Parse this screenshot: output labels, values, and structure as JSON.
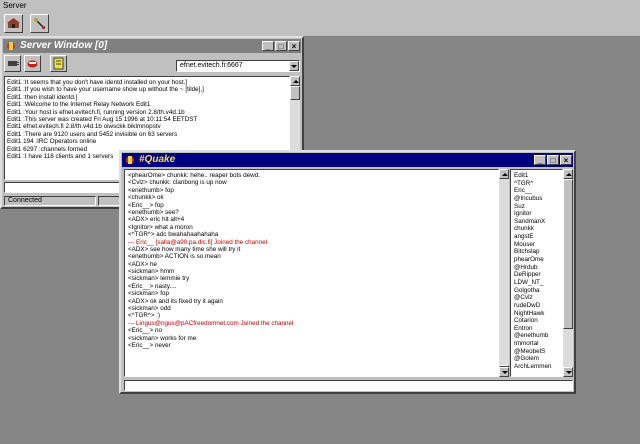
{
  "menu": {
    "items": [
      "Server"
    ]
  },
  "toolbar": {
    "buttons": [
      "connect-icon",
      "options-icon"
    ]
  },
  "server_window": {
    "title": "Server Window [0]",
    "server_select": "efnet.evitech.fi:6667",
    "lines": [
      "Edit1 :It seems that you don't have identd installed on your host.]",
      "Edit1 :If you wish to have your username show up without the ~ [tilde],]",
      "Edit1 :then install identd.]",
      "Edit1 :Welcome to the Internet Relay Network Edit1",
      "Edit1 :Your host is efnet.evitech.fi, running version 2.8/th.v4d.1b",
      "Edit1 :This server was created Fri Aug 15 1996 at 10:11:54 EETDST",
      "Edit1 efnet.evitech.fi 2.8/th.v4d.1b oiwsckk biklmnopstv",
      "Edit1 :There are 9120 users and 5452 invisible on 63 servers",
      "Edit1 194 :IRC Operators online",
      "Edit1 6297 :channels formed",
      "Edit1 :I have 118 clients and 1 servers"
    ],
    "status": "Connected"
  },
  "channel_window": {
    "title": "#Quake",
    "messages": [
      {
        "text": "<phearOme> chunkk: hehe.. reaper bots dewd.",
        "color": "#000000"
      },
      {
        "text": "<Cvlz> chunkk: clanbong is up now",
        "color": "#000000"
      },
      {
        "text": "<enethumb> fop",
        "color": "#000000"
      },
      {
        "text": "<chunkk> ok",
        "color": "#000000"
      },
      {
        "text": "<Eric__> fop",
        "color": "#000000"
      },
      {
        "text": "<enethumb> see?",
        "color": "#000000"
      },
      {
        "text": "<ADX> eric hit alt+4",
        "color": "#000000"
      },
      {
        "text": "<Ignitor> what a moron",
        "color": "#000000"
      },
      {
        "text": "<^TGR^> adc bwahahaahahaha",
        "color": "#000000"
      },
      {
        "text": "--- Eric__ [salla@a90.pa.dlc.fi] Joined the channel",
        "color": "#c00000"
      },
      {
        "text": "<ADX> see how many time she will try it",
        "color": "#000000"
      },
      {
        "text": "<enethumb> ACTION is so mean",
        "color": "#000000"
      },
      {
        "text": "<ADX> he",
        "color": "#000000"
      },
      {
        "text": "<sickman> hmm",
        "color": "#000000"
      },
      {
        "text": "<sickman> lemmie try",
        "color": "#000000"
      },
      {
        "text": "<Eric__> nasty....",
        "color": "#000000"
      },
      {
        "text": "<sickman> fop",
        "color": "#000000"
      },
      {
        "text": "<ADX> ok and its fixed try it again",
        "color": "#000000"
      },
      {
        "text": "<sickman> odd",
        "color": "#000000"
      },
      {
        "text": "<^TGR^> :)",
        "color": "#000000"
      },
      {
        "text": "--- Lingus@ngus@pACfreedomnet.com Joined the channel",
        "color": "#c00000"
      },
      {
        "text": "<Eric__> no",
        "color": "#000000"
      },
      {
        "text": "<sickman> works for me",
        "color": "#000000"
      },
      {
        "text": "<Eric__> never",
        "color": "#000000"
      }
    ],
    "nicklist": [
      "Edit1",
      "^TGR^",
      "Eric__",
      "@Incubus",
      "Suz",
      "Ignitor",
      "SandmanX",
      "chunkk",
      "angstE",
      "Mouser",
      "Bitchslap",
      "phearOme",
      "@Hrdub",
      "DeRipper",
      "LDW_NT_",
      "Golgotha",
      "@Cvlz",
      "rudeDwD",
      "NightHawk",
      "Cotarion",
      "Entron",
      "@enethumb",
      "Immortal",
      "@MeobelS",
      "@Golem",
      "ArchLemmen"
    ]
  }
}
